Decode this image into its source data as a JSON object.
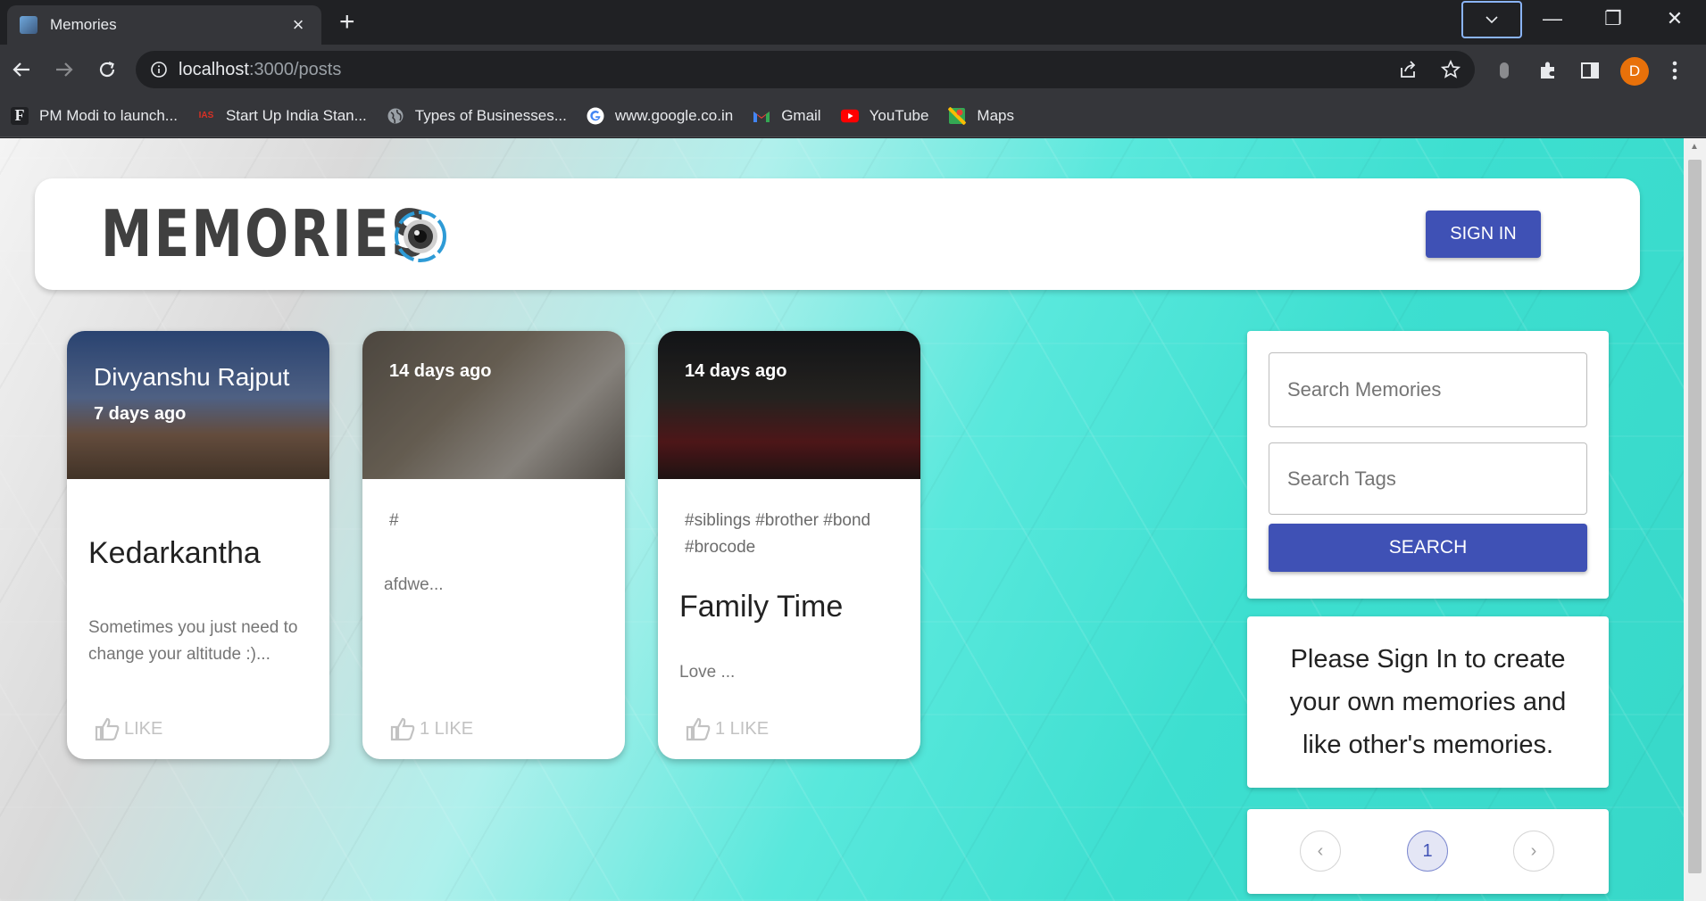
{
  "browser": {
    "tab_title": "Memories",
    "tab_close": "×",
    "new_tab": "+",
    "url_host": "localhost",
    "url_path": ":3000/posts",
    "profile_initial": "D",
    "window_controls": {
      "minimize": "—",
      "restore": "❐",
      "close": "✕"
    },
    "bookmarks": [
      {
        "label": "PM Modi to launch...",
        "icon": "f-icon"
      },
      {
        "label": "Start Up India Stan...",
        "icon": "ias-icon"
      },
      {
        "label": "Types of Businesses...",
        "icon": "globe-icon"
      },
      {
        "label": "www.google.co.in",
        "icon": "google-icon"
      },
      {
        "label": "Gmail",
        "icon": "gmail-icon"
      },
      {
        "label": "YouTube",
        "icon": "youtube-icon"
      },
      {
        "label": "Maps",
        "icon": "maps-icon"
      }
    ]
  },
  "header": {
    "brand": "MEMORIES",
    "signin_label": "SIGN IN"
  },
  "posts": [
    {
      "author": "Divyanshu Rajput",
      "time": "7 days ago",
      "tags": "",
      "title": "Kedarkantha",
      "message": "Sometimes you just need to change your altitude :)...",
      "likes": "LIKE"
    },
    {
      "author": "",
      "time": "14 days ago",
      "tags": "#",
      "title": "",
      "message": "afdwe...",
      "likes": "1 LIKE"
    },
    {
      "author": "",
      "time": "14 days ago",
      "tags": "#siblings #brother #bond #brocode",
      "title": "Family Time",
      "message": "Love ...",
      "likes": "1 LIKE"
    }
  ],
  "search": {
    "memories_placeholder": "Search Memories",
    "tags_placeholder": "Search Tags",
    "button_label": "SEARCH"
  },
  "info": {
    "message": "Please Sign In to create your own memories and like other's memories."
  },
  "pagination": {
    "prev": "‹",
    "current_page": "1",
    "next": "›"
  },
  "colors": {
    "primary": "#3f51b5",
    "chrome_dark": "#202124",
    "chrome_toolbar": "#35363a"
  }
}
